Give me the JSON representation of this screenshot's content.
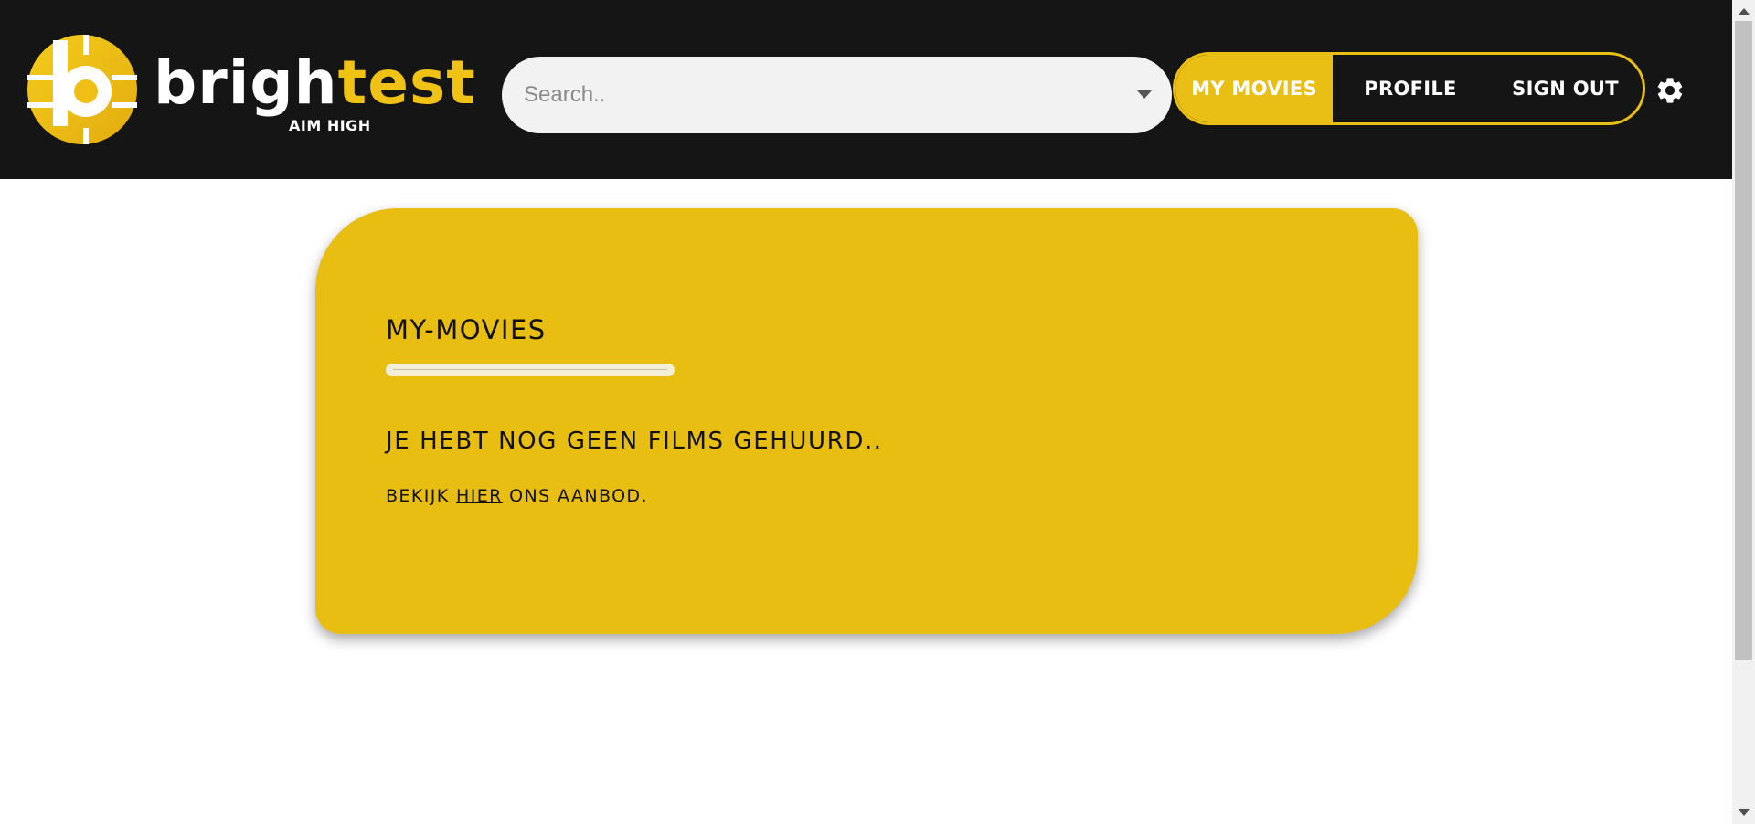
{
  "colors": {
    "header_bg": "#151515",
    "accent": "#e9be12",
    "page_bg": "#ffffff"
  },
  "header": {
    "logo": {
      "word_white": "brigh",
      "word_yellow": "test",
      "tagline": "AIM HIGH"
    },
    "search": {
      "placeholder": "Search.."
    },
    "nav": {
      "items": [
        {
          "label": "MY MOVIES",
          "active": true
        },
        {
          "label": "PROFILE",
          "active": false
        },
        {
          "label": "SIGN OUT",
          "active": false
        }
      ]
    },
    "settings_icon": "gear-icon"
  },
  "card": {
    "title": "MY-MOVIES",
    "message": "JE HEBT NOG GEEN FILMS GEHUURD..",
    "sub_before": "BEKIJK ",
    "sub_link": "HIER",
    "sub_after": " ONS AANBOD."
  }
}
